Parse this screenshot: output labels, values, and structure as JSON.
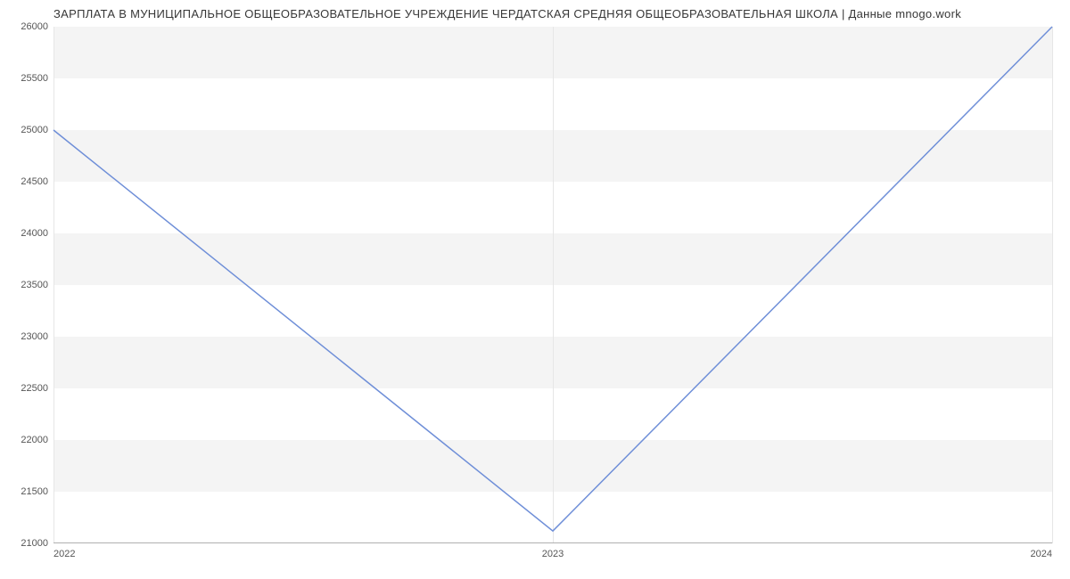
{
  "chart_data": {
    "type": "line",
    "title": "ЗАРПЛАТА В МУНИЦИПАЛЬНОЕ ОБЩЕОБРАЗОВАТЕЛЬНОЕ УЧРЕЖДЕНИЕ  ЧЕРДАТСКАЯ СРЕДНЯЯ ОБЩЕОБРАЗОВАТЕЛЬНАЯ ШКОЛА | Данные mnogo.work",
    "xlabel": "",
    "ylabel": "",
    "x_ticks": [
      "2022",
      "2023",
      "2024"
    ],
    "y_ticks": [
      21000,
      21500,
      22000,
      22500,
      23000,
      23500,
      24000,
      24500,
      25000,
      25500,
      26000
    ],
    "ylim": [
      21000,
      26000
    ],
    "series": [
      {
        "name": "salary",
        "x": [
          "2022",
          "2023",
          "2024"
        ],
        "values": [
          25000,
          21120,
          26000
        ]
      }
    ],
    "colors": {
      "line": "#6f8fd8",
      "band": "#f4f4f4",
      "bg": "#ffffff"
    }
  }
}
